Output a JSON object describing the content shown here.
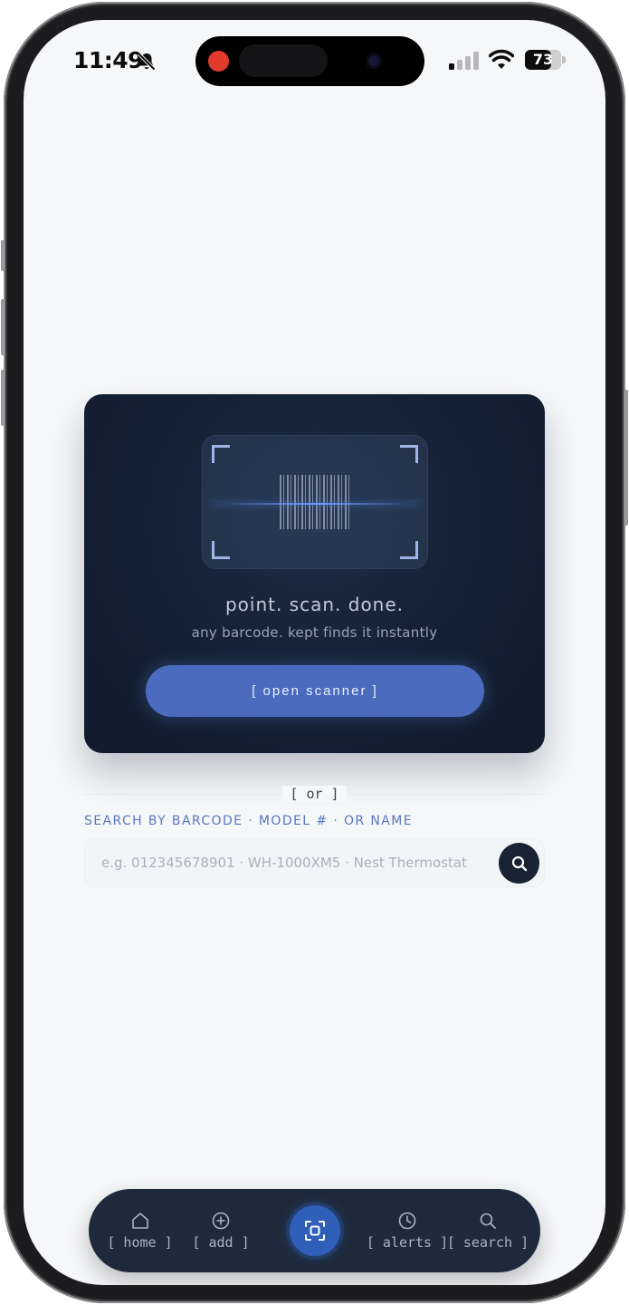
{
  "status_bar": {
    "time": "11:49",
    "battery": "73",
    "battery_fraction": 0.73
  },
  "icons": {
    "bell_slash": "bell-slash-icon",
    "signal": "cellular-signal-icon",
    "wifi": "wifi-icon",
    "battery": "battery-icon",
    "search": "search-icon",
    "home": "home-icon",
    "add": "add-circle-icon",
    "scan": "scan-icon",
    "alerts": "clock-icon"
  },
  "scan_card": {
    "title": "point. scan. done.",
    "subtitle": "any barcode. kept finds it instantly",
    "button_label": "[ open scanner ]"
  },
  "divider": {
    "or_label": "[ or ]"
  },
  "search": {
    "caption": "SEARCH BY BARCODE · MODEL # · OR NAME",
    "placeholder": "e.g. 012345678901 · WH-1000XM5 · Nest Thermostat",
    "value": ""
  },
  "bottom_nav": {
    "items": [
      {
        "label": "[ home ]"
      },
      {
        "label": "[ add ]"
      },
      {
        "label": "[ alerts ]"
      },
      {
        "label": "[ search ]"
      }
    ]
  },
  "colors": {
    "accent": "#4b6cbe",
    "card_bg": "#152236",
    "nav_bg": "#1e2a3b",
    "caption": "#5877bf",
    "record_indicator": "#e23b2e"
  }
}
